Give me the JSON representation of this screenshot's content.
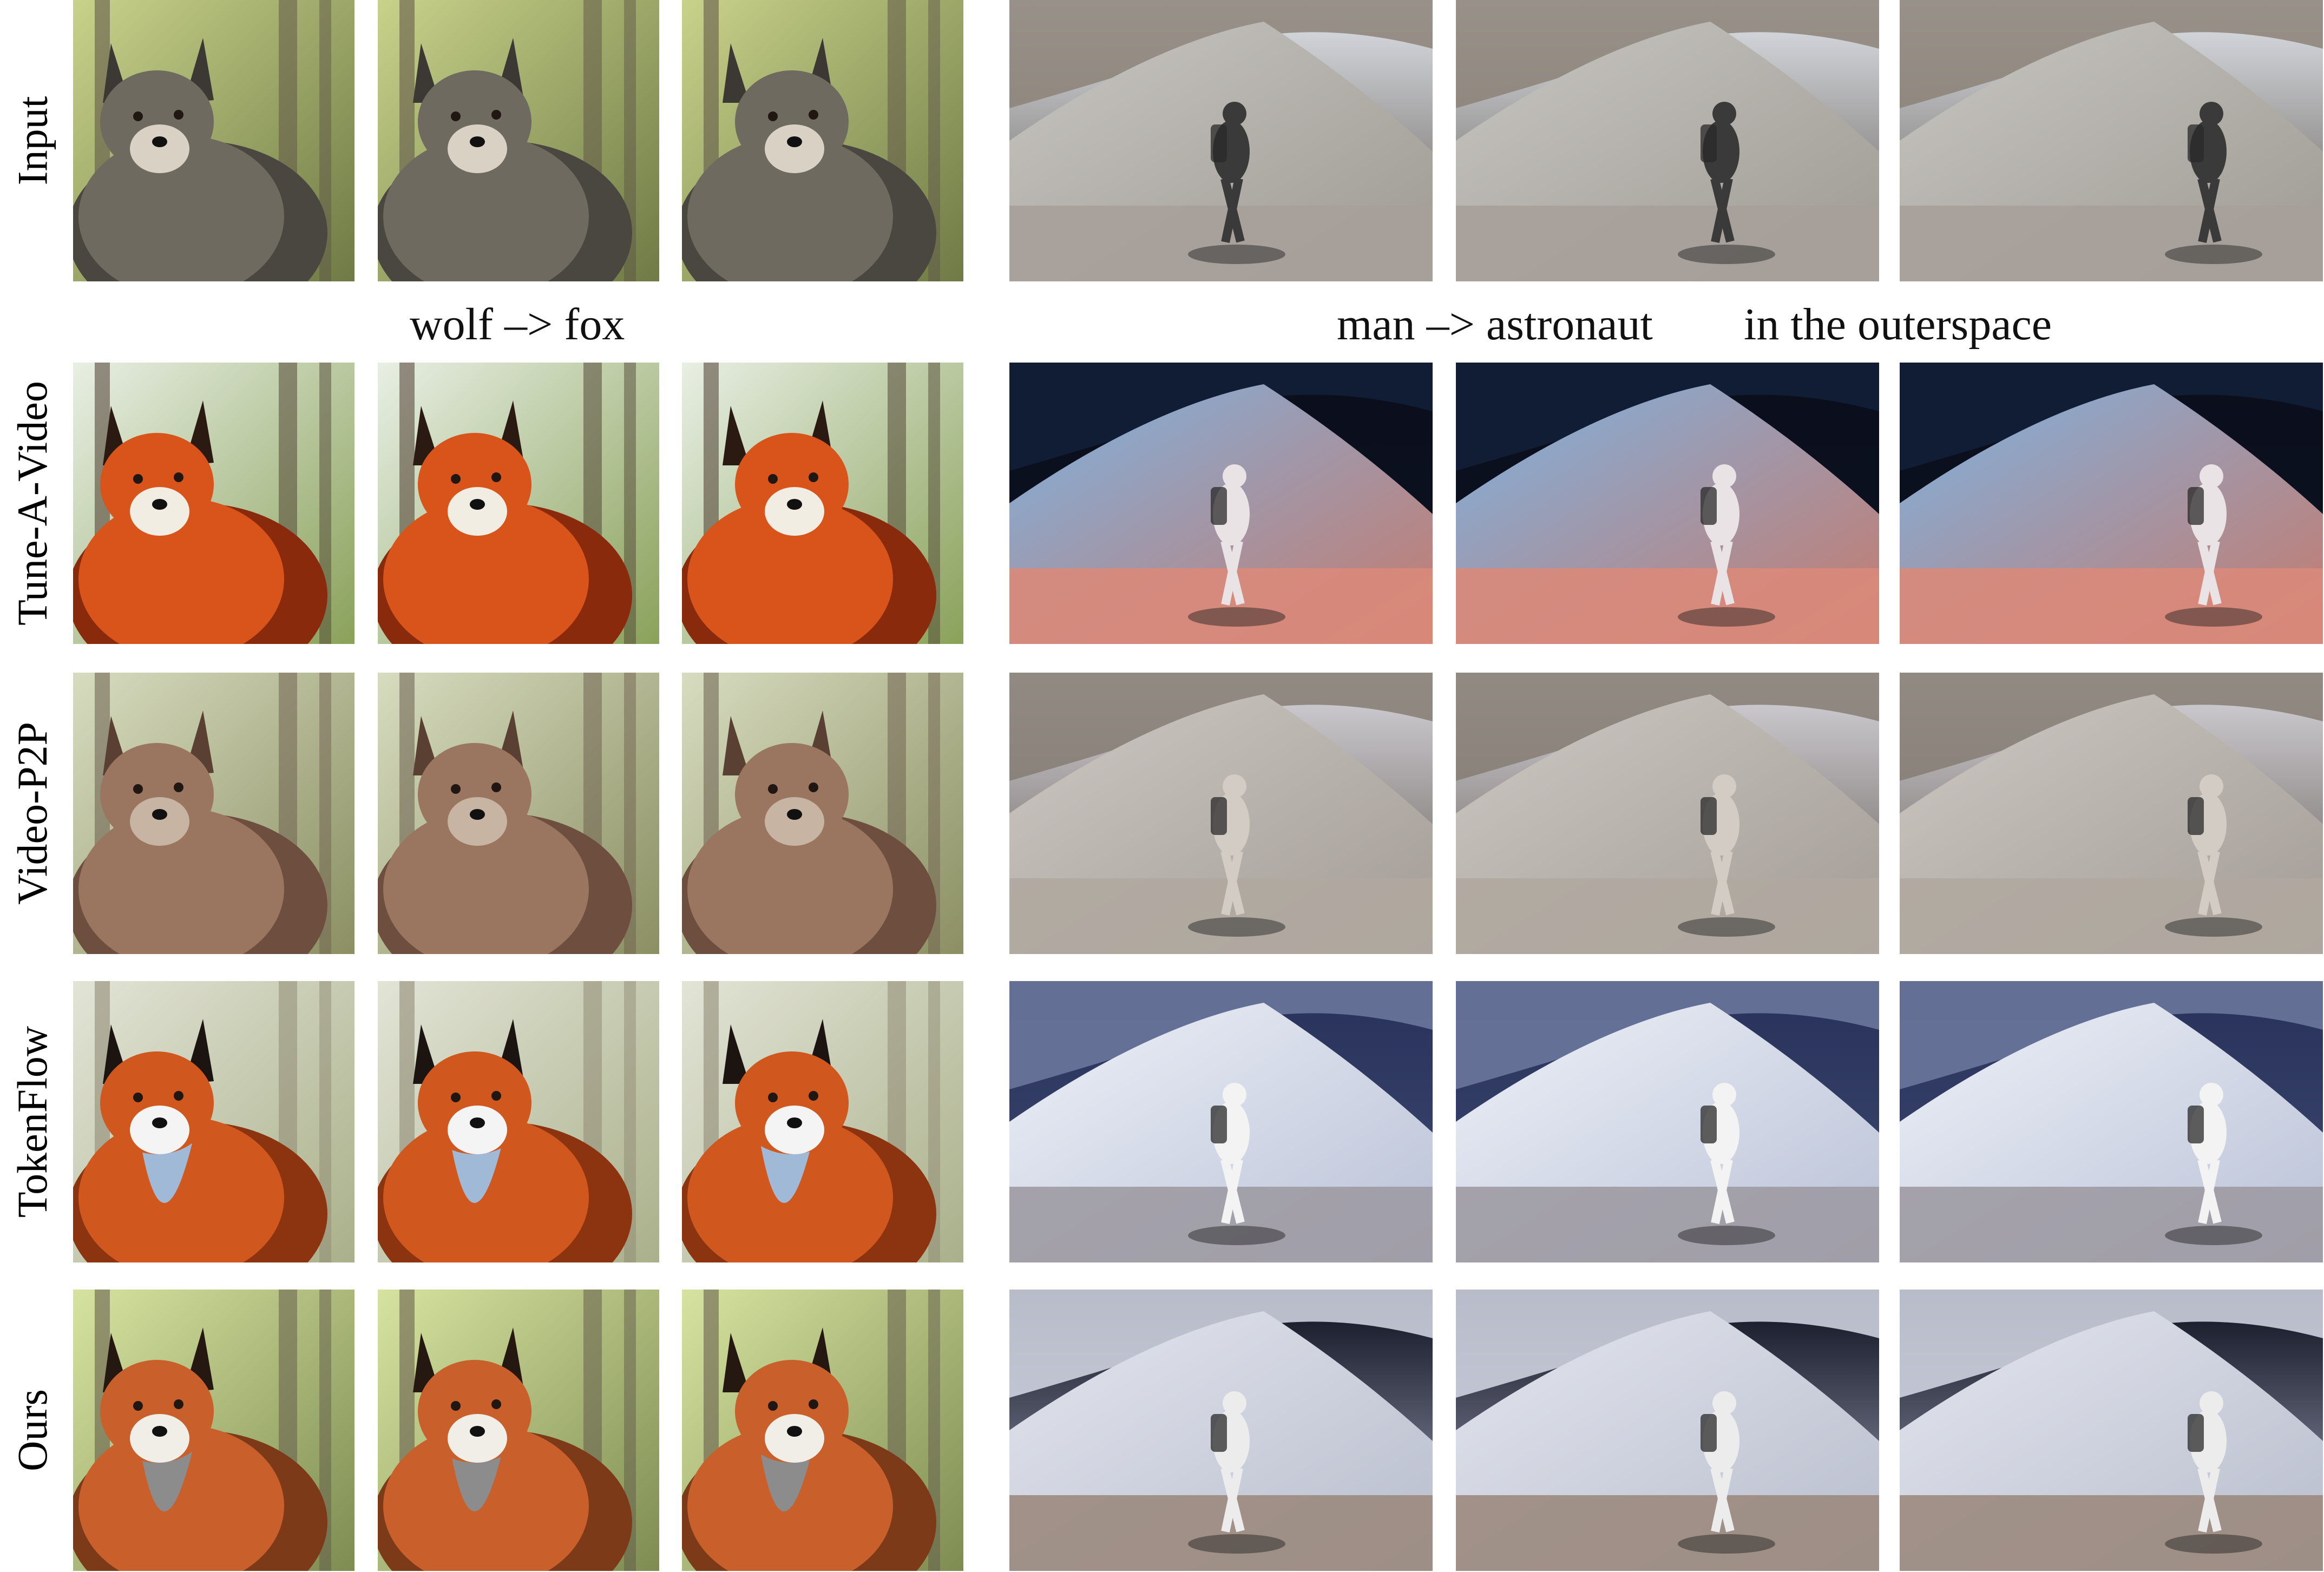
{
  "row_labels": [
    "Input",
    "Tune-A-Video",
    "Video-P2P",
    "TokenFlow",
    "Ours"
  ],
  "captions": {
    "left": "wolf –> fox",
    "right_main": "man –> astronaut",
    "right_suffix": "in the outerspace"
  },
  "frames": {
    "input": [
      "wolf-in-forest",
      "hiker-on-mountain-slope"
    ],
    "tune_a_video": [
      "orange-fox-forest",
      "astronaut-in-space-over-planet"
    ],
    "video_p2p": [
      "blurry-brown-fox",
      "astronaut-on-mountain-slope"
    ],
    "tokenflow": [
      "red-fox-blue-chest",
      "astronaut-on-snowy-slope"
    ],
    "ours": [
      "red-fox-natural",
      "astronaut-on-moon-surface"
    ]
  },
  "colors": {
    "background": "#ffffff",
    "text": "#000000"
  }
}
